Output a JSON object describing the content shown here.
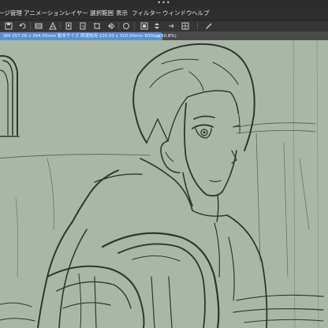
{
  "window": {
    "handle": "•••"
  },
  "menu": {
    "items": [
      {
        "label": "ージ管理"
      },
      {
        "label": "アニメーション"
      },
      {
        "label": "レイヤー"
      },
      {
        "label": "選択範囲"
      },
      {
        "label": "表示"
      },
      {
        "label": "フィルター"
      },
      {
        "label": "ウィンドウ"
      },
      {
        "label": "ヘルプ"
      }
    ]
  },
  "toolbar": {
    "tools": [
      "save-icon",
      "undo-icon",
      "clear-icon",
      "fill-icon",
      "copy-icon",
      "paste-icon",
      "crop-icon",
      "flip-icon",
      "rotate-icon",
      "snap-icon",
      "color-swatch-icon",
      "arrows-icon",
      "grid-icon",
      "pen-icon"
    ]
  },
  "document": {
    "tab_label": "(B4 257.00 x 364.00mm 製本サイズ 調漫誌用 220.00 x 310.00mm 600dpi 50.8%)",
    "close_glyph": "×"
  },
  "colors": {
    "menubar_bg": "#2e2e2e",
    "tab_active": "#5b8fd6",
    "canvas_bg": "#a9b8a6",
    "line_color": "#2f3630"
  }
}
